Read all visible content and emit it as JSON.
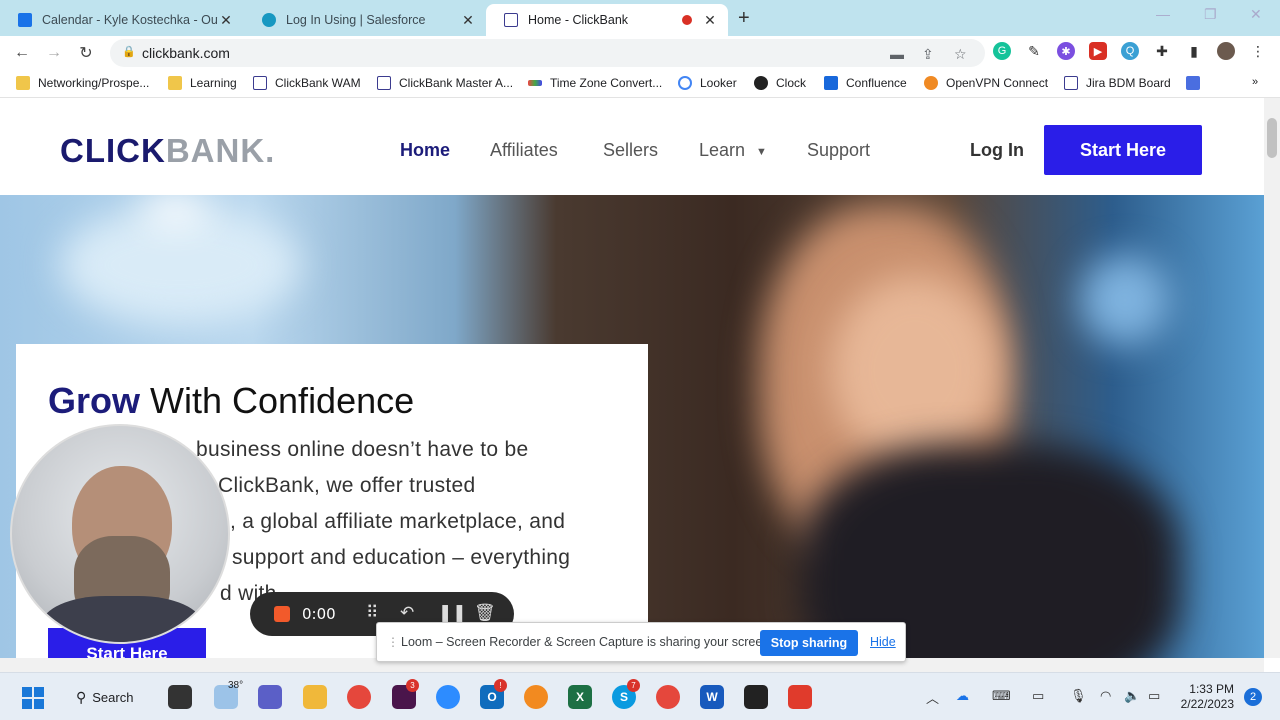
{
  "browser": {
    "tabs": [
      {
        "title": "Calendar - Kyle Kostechka - Out",
        "favicon": "outlook-icon",
        "color": "#1a73e8"
      },
      {
        "title": "Log In Using | Salesforce",
        "favicon": "salesforce-icon",
        "color": "#1798c1"
      },
      {
        "title": "Home - ClickBank",
        "favicon": "clickbank-icon",
        "color": "#3b3b8f"
      }
    ],
    "url": "clickbank.com",
    "bookmarks": [
      {
        "label": "Networking/Prospe...",
        "icon": "folder-icon"
      },
      {
        "label": "Learning",
        "icon": "folder-icon"
      },
      {
        "label": "ClickBank WAM",
        "icon": "clickbank-icon"
      },
      {
        "label": "ClickBank Master A...",
        "icon": "clickbank-icon"
      },
      {
        "label": "Time Zone Convert...",
        "icon": "timezone-icon"
      },
      {
        "label": "Looker",
        "icon": "looker-icon"
      },
      {
        "label": "Clock",
        "icon": "clock-icon"
      },
      {
        "label": "Confluence",
        "icon": "confluence-icon"
      },
      {
        "label": "OpenVPN Connect",
        "icon": "openvpn-icon"
      },
      {
        "label": "Jira BDM Board",
        "icon": "clickbank-icon"
      }
    ]
  },
  "site": {
    "logo_main": "CLICK",
    "logo_accent": "BANK.",
    "nav": [
      {
        "label": "Home",
        "active": true
      },
      {
        "label": "Affiliates",
        "active": false
      },
      {
        "label": "Sellers",
        "active": false
      },
      {
        "label": "Learn",
        "active": false
      },
      {
        "label": "Support",
        "active": false
      }
    ],
    "login": "Log In",
    "cta": "Start Here",
    "hero": {
      "headline_strong": "Grow",
      "headline_rest": " With Confidence",
      "body_lines": [
        "business online doesn’t have to be",
        "ClickBank, we offer trusted",
        ", a global affiliate marketplace, and",
        "support and education – everything",
        "d with"
      ],
      "cta": "Start Here"
    }
  },
  "loom": {
    "timer": "0:00",
    "share_message": "Loom – Screen Recorder & Screen Capture is sharing your screen.",
    "stop_label": "Stop sharing",
    "hide_label": "Hide"
  },
  "taskbar": {
    "search_label": "Search",
    "weather_temp": "38°",
    "time": "1:33 PM",
    "date": "2/22/2023",
    "notifications": "2",
    "badges": {
      "slack": "3",
      "outlook": "!",
      "skype": "7"
    }
  },
  "colors": {
    "brand": "#1c1c7a",
    "cta": "#2a1ee8",
    "tabstrip": "#bfe3ee"
  }
}
